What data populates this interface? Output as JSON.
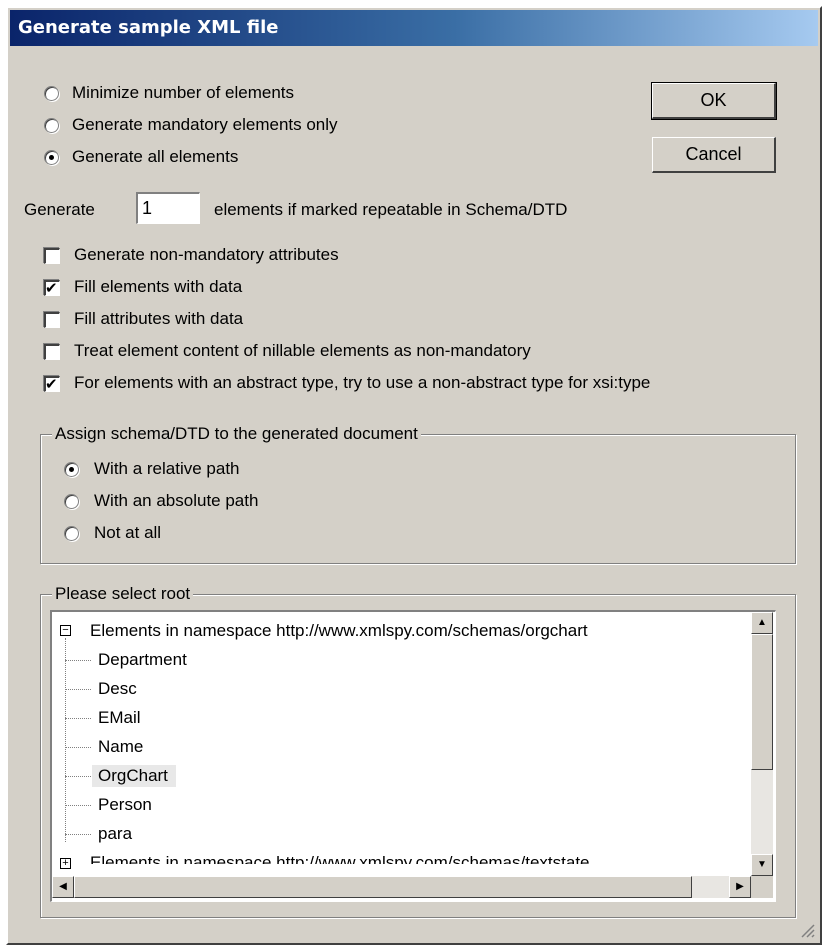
{
  "window": {
    "title": "Generate sample XML file"
  },
  "generation_mode": {
    "options": [
      {
        "label": "Minimize number of elements",
        "selected": false
      },
      {
        "label": "Generate mandatory elements only",
        "selected": false
      },
      {
        "label": "Generate all elements",
        "selected": true
      }
    ]
  },
  "buttons": {
    "ok": "OK",
    "cancel": "Cancel"
  },
  "repeat": {
    "prefix": "Generate",
    "value": "1",
    "suffix": "elements if marked repeatable in Schema/DTD"
  },
  "checkboxes": [
    {
      "label": "Generate non-mandatory attributes",
      "checked": false
    },
    {
      "label": "Fill elements with data",
      "checked": true
    },
    {
      "label": "Fill attributes with data",
      "checked": false
    },
    {
      "label": "Treat element content of nillable elements as non-mandatory",
      "checked": false
    },
    {
      "label": "For elements with an abstract type, try to use a non-abstract type for xsi:type",
      "checked": true
    }
  ],
  "assign_group": {
    "legend": "Assign schema/DTD to the generated document",
    "options": [
      {
        "label": "With a relative path",
        "selected": true
      },
      {
        "label": "With an absolute path",
        "selected": false
      },
      {
        "label": "Not at all",
        "selected": false
      }
    ]
  },
  "root_group": {
    "legend": "Please select root",
    "namespace_1": "Elements in namespace http://www.xmlspy.com/schemas/orgchart",
    "items": [
      "Department",
      "Desc",
      "EMail",
      "Name",
      "OrgChart",
      "Person",
      "para"
    ],
    "selected_item": "OrgChart",
    "namespace_2": "Elements in namespace http://www.xmlspy.com/schemas/textstate"
  },
  "icons": {
    "expander": "minus-expander-icon",
    "scroll_up": "arrow-up-icon",
    "scroll_down": "arrow-down-icon",
    "scroll_left": "arrow-left-icon",
    "scroll_right": "arrow-right-icon",
    "resize": "resize-grip-icon"
  }
}
